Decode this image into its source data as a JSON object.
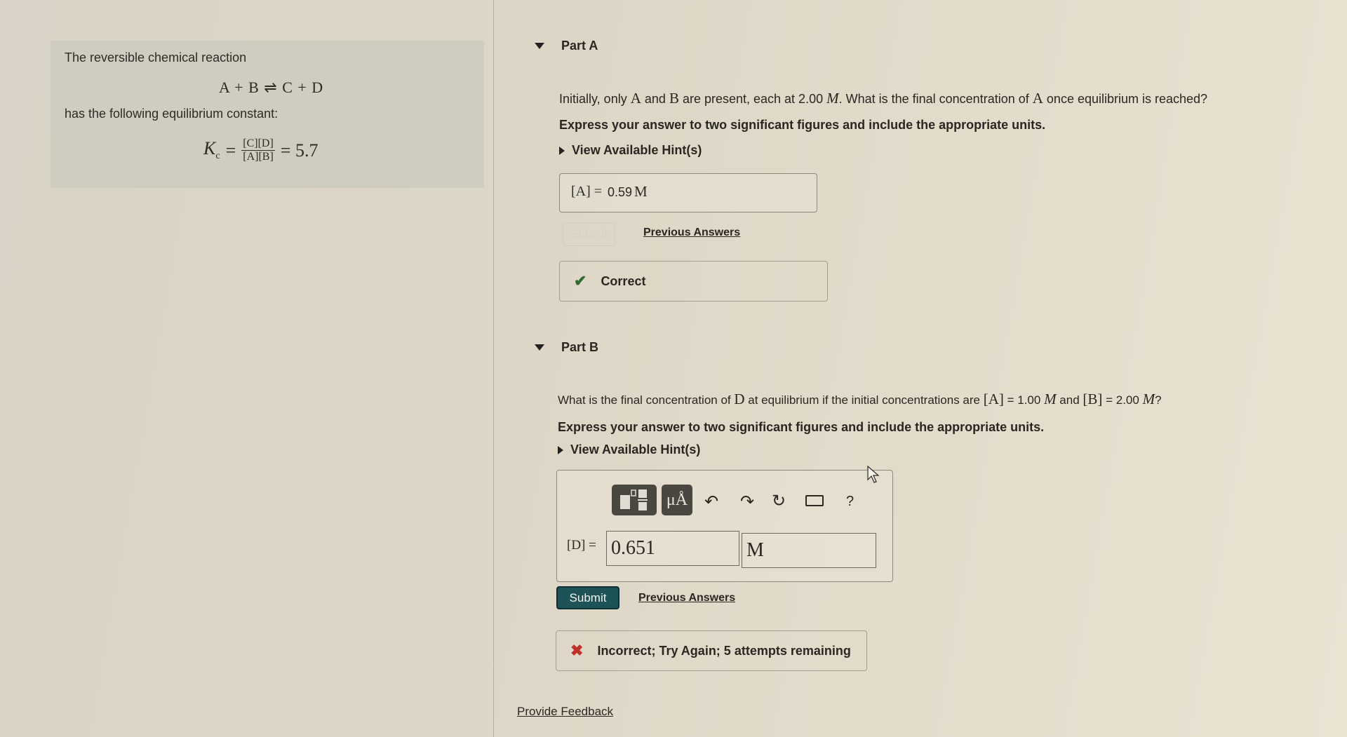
{
  "problem": {
    "intro_line1": "The reversible chemical reaction",
    "reaction": "A + B ⇌ C + D",
    "intro_line2": "has the following equilibrium constant:",
    "kc_symbol": "K",
    "kc_subscript": "c",
    "kc_numerator": "[C][D]",
    "kc_denominator": "[A][B]",
    "kc_value": "= 5.7"
  },
  "part_a": {
    "title": "Part A",
    "question_pre": "Initially, only ",
    "q_A": "A",
    "q_and": " and ",
    "q_B": "B",
    "q_mid": " are present, each at 2.00 ",
    "q_M": "M",
    "q_post": ". What is the final concentration of ",
    "q_A2": "A",
    "q_end": " once equilibrium is reached?",
    "instructions": "Express your answer to two significant figures and include the appropriate units.",
    "hint_label": "View Available Hint(s)",
    "answer_label": "[A] =",
    "answer_value": "0.59",
    "answer_unit": "M",
    "submit_label": "Submit",
    "previous_answers_label": "Previous Answers",
    "feedback_text": "Correct",
    "feedback_status": "correct"
  },
  "part_b": {
    "title": "Part B",
    "question_pre": "What is the final concentration of ",
    "q_D": "D",
    "q_mid": " at equilibrium if the initial concentrations are ",
    "q_A": "[A]",
    "q_A_val": " = 1.00 ",
    "q_M1": "M",
    "q_and": " and ",
    "q_B": "[B]",
    "q_B_val": " = 2.00 ",
    "q_M2": "M",
    "q_end": "?",
    "instructions": "Express your answer to two significant figures and include the appropriate units.",
    "hint_label": "View Available Hint(s)",
    "toolbar": {
      "templates_icon": "templates-icon",
      "units_label": "μÅ",
      "undo_icon": "undo-icon",
      "redo_icon": "redo-icon",
      "reset_icon": "reset-icon",
      "keyboard_icon": "keyboard-icon",
      "help_label": "?"
    },
    "answer_label": "[D] =",
    "value_input": "0.651",
    "unit_input": "M",
    "submit_label": "Submit",
    "previous_answers_label": "Previous Answers",
    "feedback_text": "Incorrect; Try Again; 5 attempts remaining",
    "feedback_status": "incorrect"
  },
  "footer": {
    "provide_feedback_label": "Provide Feedback"
  },
  "colors": {
    "submit_bg": "#1d5256",
    "correct": "#2e6b2e",
    "incorrect": "#c0302a"
  }
}
